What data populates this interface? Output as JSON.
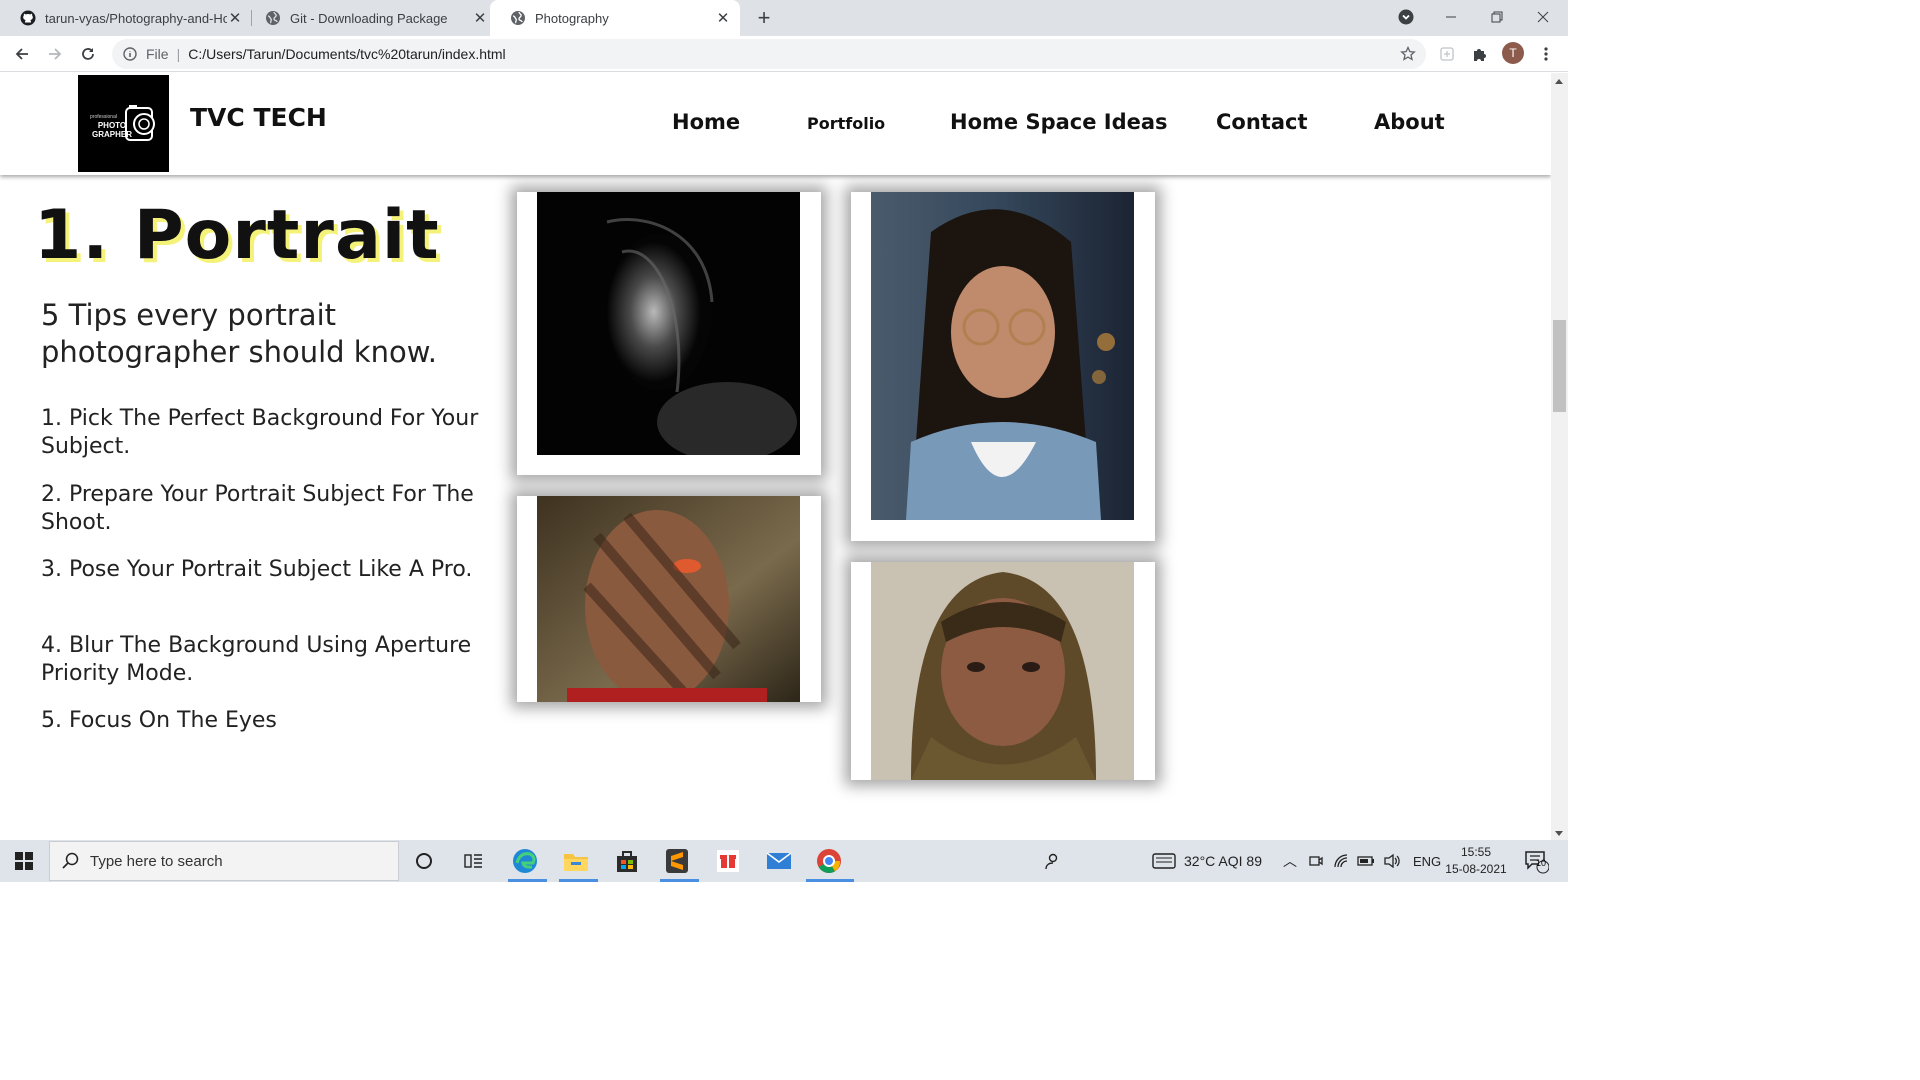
{
  "browser": {
    "tabs": [
      {
        "title": "tarun-vyas/Photography-and-Ho",
        "favicon": "github-icon",
        "active": false
      },
      {
        "title": "Git - Downloading Package",
        "favicon": "globe-icon",
        "active": false
      },
      {
        "title": "Photography",
        "favicon": "globe-icon",
        "active": true
      }
    ],
    "address": {
      "scheme_label": "File",
      "url": "C:/Users/Tarun/Documents/tvc%20tarun/index.html"
    },
    "profile_initial": "T"
  },
  "site": {
    "logo": {
      "line1": "professional",
      "line2": "PHOTO",
      "line3": "GRAPHER"
    },
    "brand": "TVC TECH",
    "nav": [
      "Home",
      "Portfolio",
      "Home Space Ideas",
      "Contact",
      "About"
    ]
  },
  "content": {
    "section_title": "1. Portrait",
    "tips_heading": "5 Tips every portrait photographer should know.",
    "tips": [
      "1. Pick The Perfect Background For Your Subject.",
      "2. Prepare Your Portrait Subject For The Shoot.",
      "3. Pose Your Portrait Subject Like A Pro.",
      "4. Blur The Background Using Aperture Priority Mode.",
      "5. Focus On The Eyes"
    ]
  },
  "taskbar": {
    "search_placeholder": "Type here to search",
    "weather": "32°C  AQI 89",
    "language": "ENG",
    "time": "15:55",
    "date": "15-08-2021",
    "notification_count": "10"
  },
  "colors": {
    "title_shadow": "#f5f27a",
    "tab_strip": "#dee1e6",
    "taskbar": "#dfe3ea"
  }
}
